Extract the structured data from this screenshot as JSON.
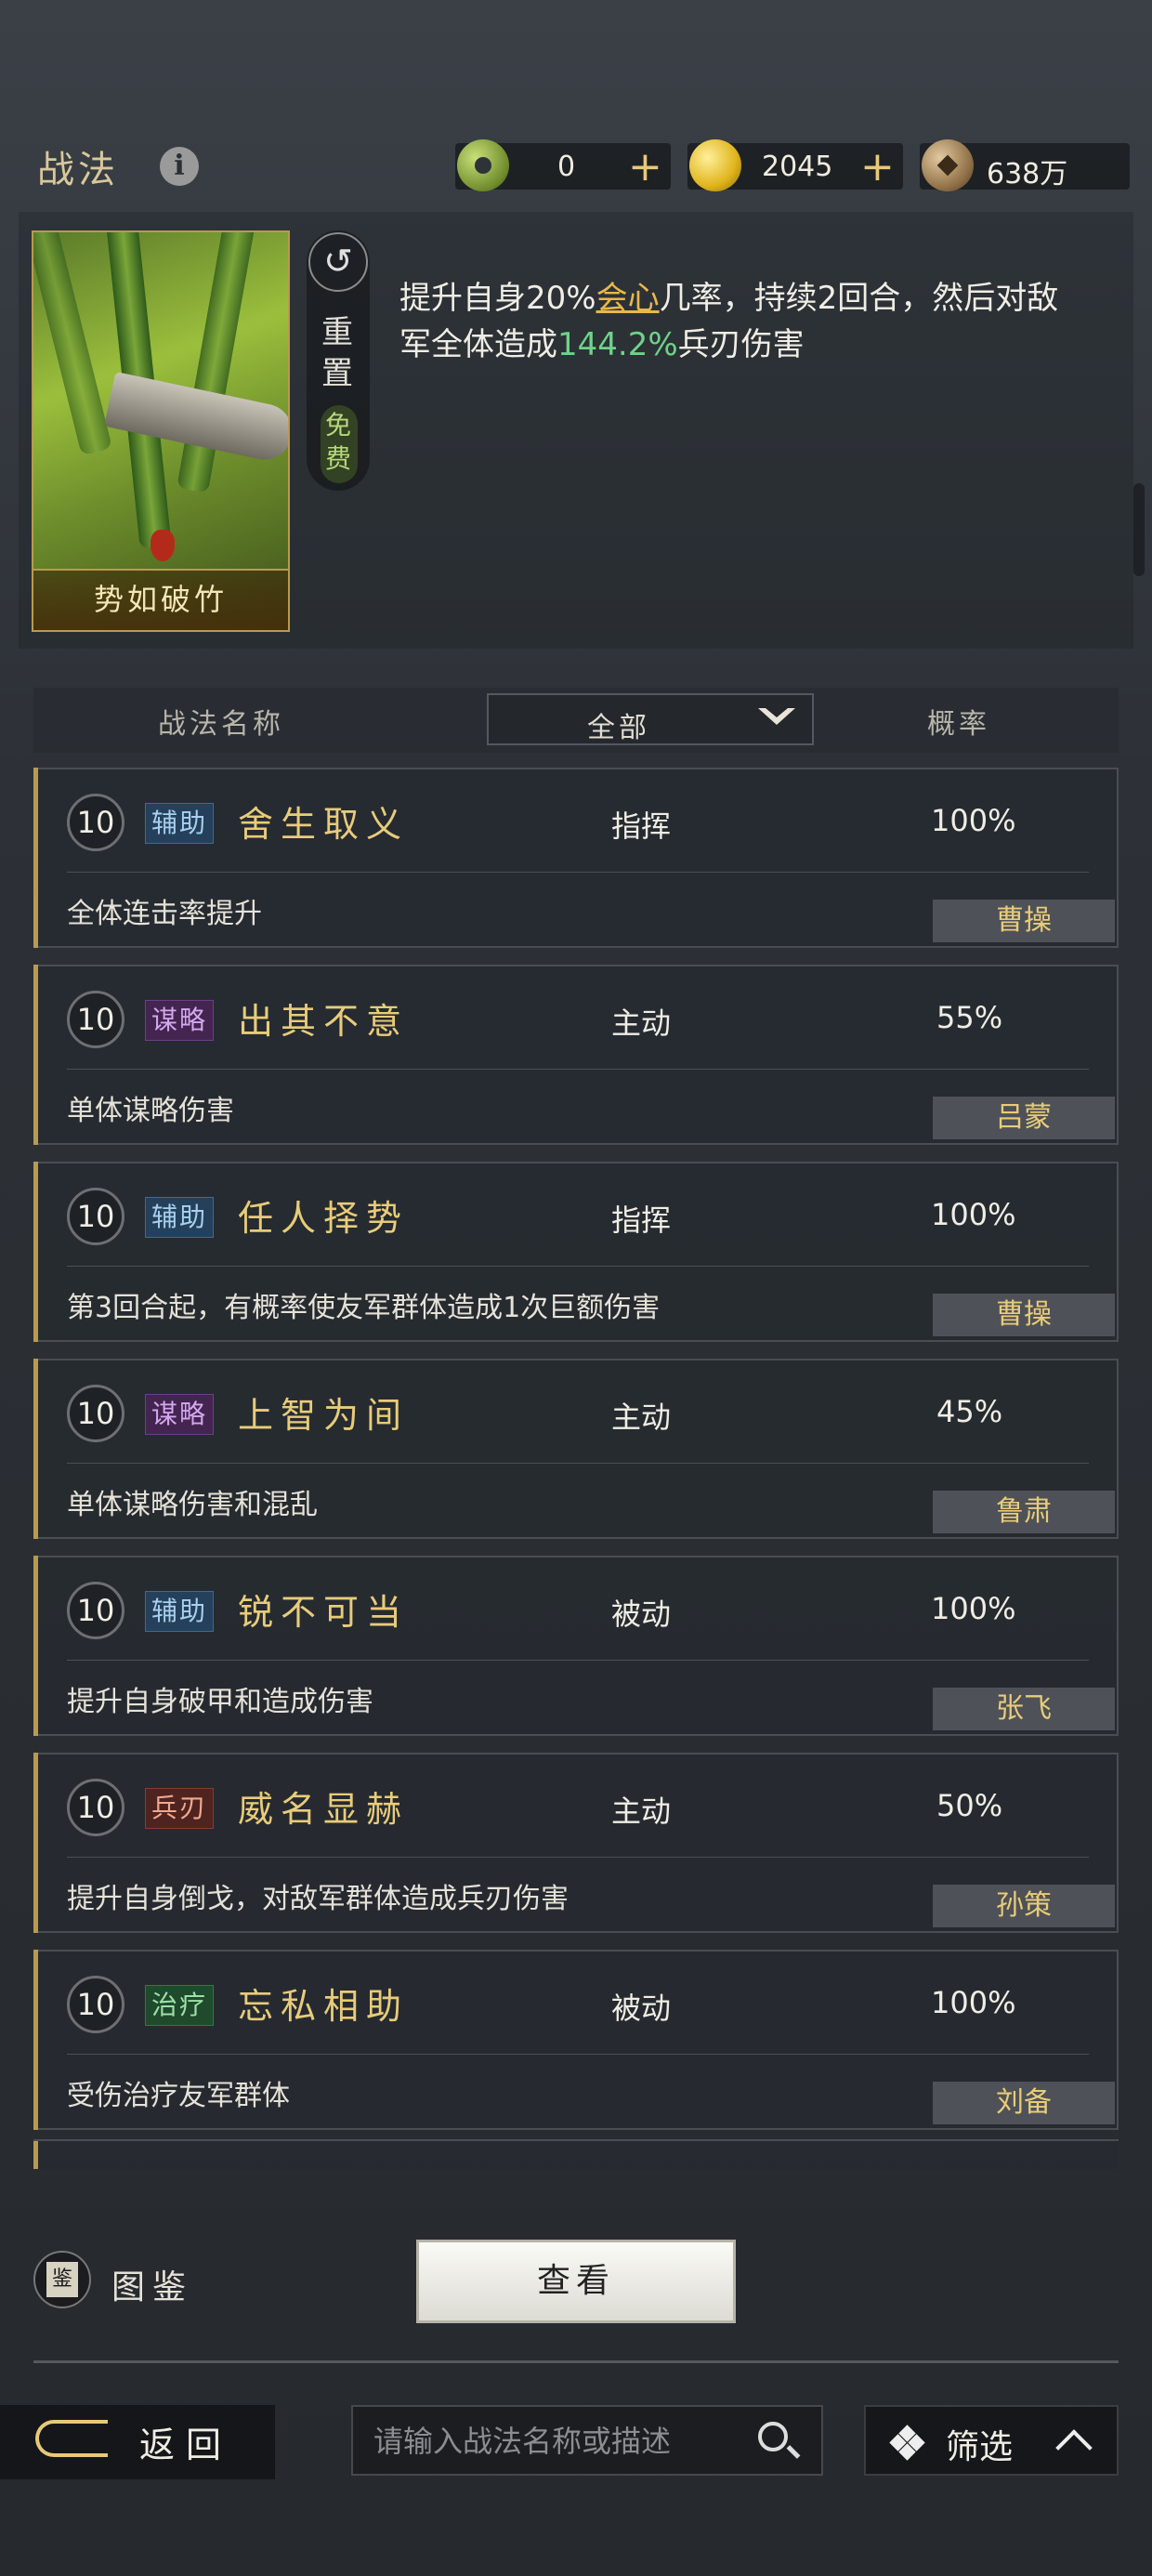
{
  "header": {
    "title": "战法",
    "currencies": [
      {
        "icon": "jade-coin-icon",
        "value": "0"
      },
      {
        "icon": "gold-coin-icon",
        "value": "2045"
      },
      {
        "icon": "copper-coin-icon",
        "value": "638万"
      }
    ]
  },
  "skill_card": {
    "name": "势如破竹",
    "reset_label": "重置",
    "free_label": "免费",
    "description": {
      "p1": "提升自身20%",
      "hl1": "会心",
      "p2": "几率，持续2回合，然后对敌军全体造成",
      "hl2": "144.2%",
      "p3": "兵刃伤害"
    }
  },
  "table_header": {
    "name_col": "战法名称",
    "filter_value": "全部",
    "rate_col": "概率"
  },
  "tactics": [
    {
      "level": "10",
      "tag": "辅助",
      "name": "舍生取义",
      "type": "指挥",
      "rate": "100%",
      "effect": "全体连击率提升",
      "hero": "曹操"
    },
    {
      "level": "10",
      "tag": "谋略",
      "name": "出其不意",
      "type": "主动",
      "rate": "55%",
      "effect": "单体谋略伤害",
      "hero": "吕蒙"
    },
    {
      "level": "10",
      "tag": "辅助",
      "name": "任人择势",
      "type": "指挥",
      "rate": "100%",
      "effect": "第3回合起，有概率使友军群体造成1次巨额伤害",
      "hero": "曹操"
    },
    {
      "level": "10",
      "tag": "谋略",
      "name": "上智为间",
      "type": "主动",
      "rate": "45%",
      "effect": "单体谋略伤害和混乱",
      "hero": "鲁肃"
    },
    {
      "level": "10",
      "tag": "辅助",
      "name": "锐不可当",
      "type": "被动",
      "rate": "100%",
      "effect": "提升自身破甲和造成伤害",
      "hero": "张飞"
    },
    {
      "level": "10",
      "tag": "兵刃",
      "name": "威名显赫",
      "type": "主动",
      "rate": "50%",
      "effect": "提升自身倒戈，对敌军群体造成兵刃伤害",
      "hero": "孙策"
    },
    {
      "level": "10",
      "tag": "治疗",
      "name": "忘私相助",
      "type": "被动",
      "rate": "100%",
      "effect": "受伤治疗友军群体",
      "hero": "刘备"
    }
  ],
  "footer": {
    "codex_label": "图鉴",
    "codex_icon_char": "鉴",
    "view_button": "查看",
    "back_label": "返回",
    "search_placeholder": "请输入战法名称或描述",
    "filter_label": "筛选"
  }
}
